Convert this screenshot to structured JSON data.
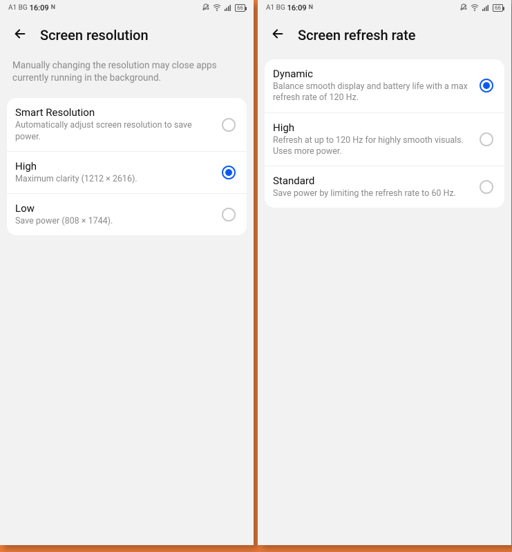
{
  "status": {
    "carrier": "A1 BG",
    "time": "16:09",
    "nfc": "N",
    "battery": "66"
  },
  "leftScreen": {
    "title": "Screen resolution",
    "description": "Manually changing the resolution may close apps currently running in the background.",
    "options": [
      {
        "title": "Smart Resolution",
        "desc": "Automatically adjust screen resolution to save power.",
        "selected": false
      },
      {
        "title": "High",
        "desc": "Maximum clarity (1212 × 2616).",
        "selected": true
      },
      {
        "title": "Low",
        "desc": "Save power (808 × 1744).",
        "selected": false
      }
    ]
  },
  "rightScreen": {
    "title": "Screen refresh rate",
    "options": [
      {
        "title": "Dynamic",
        "desc": "Balance smooth display and battery life with a max refresh rate of 120 Hz.",
        "selected": true
      },
      {
        "title": "High",
        "desc": "Refresh at up to 120 Hz for highly smooth visuals. Uses more power.",
        "selected": false
      },
      {
        "title": "Standard",
        "desc": "Save power by limiting the refresh rate to 60 Hz.",
        "selected": false
      }
    ]
  }
}
